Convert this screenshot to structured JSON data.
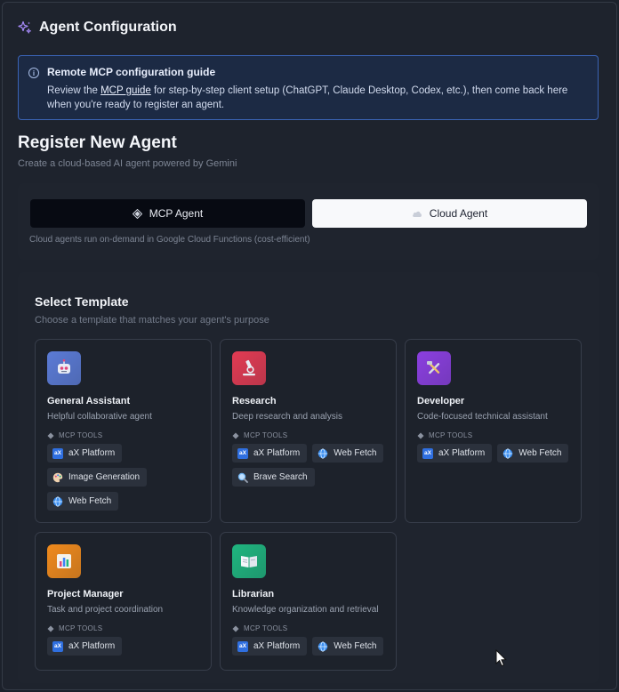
{
  "header": {
    "title": "Agent Configuration",
    "icon": "sparkles-icon",
    "icon_color": "#a78bfa"
  },
  "banner": {
    "title": "Remote MCP configuration guide",
    "text_before": "Review the ",
    "link": "MCP guide",
    "text_after": " for step-by-step client setup (ChatGPT, Claude Desktop, Codex, etc.), then come back here when you're ready to register an agent."
  },
  "register": {
    "title": "Register New Agent",
    "subtitle": "Create a cloud-based AI agent powered by Gemini",
    "mcp_label": "MCP Agent",
    "cloud_label": "Cloud Agent",
    "note": "Cloud agents run on-demand in Google Cloud Functions (cost-efficient)"
  },
  "templates": {
    "title": "Select Template",
    "subtitle": "Choose a template that matches your agent's purpose",
    "tools_label": "MCP TOOLS",
    "items": [
      {
        "name": "General Assistant",
        "desc": "Helpful collaborative agent",
        "icon": "robot-icon",
        "color": "#5b7bd6",
        "tools": [
          {
            "label": "aX Platform",
            "icon": "ax-icon"
          },
          {
            "label": "Image Generation",
            "icon": "palette-icon"
          },
          {
            "label": "Web Fetch",
            "icon": "globe-icon"
          }
        ]
      },
      {
        "name": "Research",
        "desc": "Deep research and analysis",
        "icon": "microscope-icon",
        "color": "#e23b53",
        "tools": [
          {
            "label": "aX Platform",
            "icon": "ax-icon"
          },
          {
            "label": "Web Fetch",
            "icon": "globe-icon"
          },
          {
            "label": "Brave Search",
            "icon": "magnifier-icon"
          }
        ]
      },
      {
        "name": "Developer",
        "desc": "Code-focused technical assistant",
        "icon": "tools-icon",
        "color": "#8b3fe0",
        "tools": [
          {
            "label": "aX Platform",
            "icon": "ax-icon"
          },
          {
            "label": "Web Fetch",
            "icon": "globe-icon"
          }
        ]
      },
      {
        "name": "Project Manager",
        "desc": "Task and project coordination",
        "icon": "chart-icon",
        "color": "#f08a1c",
        "tools": [
          {
            "label": "aX Platform",
            "icon": "ax-icon"
          }
        ]
      },
      {
        "name": "Librarian",
        "desc": "Knowledge organization and retrieval",
        "icon": "book-icon",
        "color": "#1fb57f",
        "tools": [
          {
            "label": "aX Platform",
            "icon": "ax-icon"
          },
          {
            "label": "Web Fetch",
            "icon": "globe-icon"
          }
        ]
      }
    ]
  }
}
